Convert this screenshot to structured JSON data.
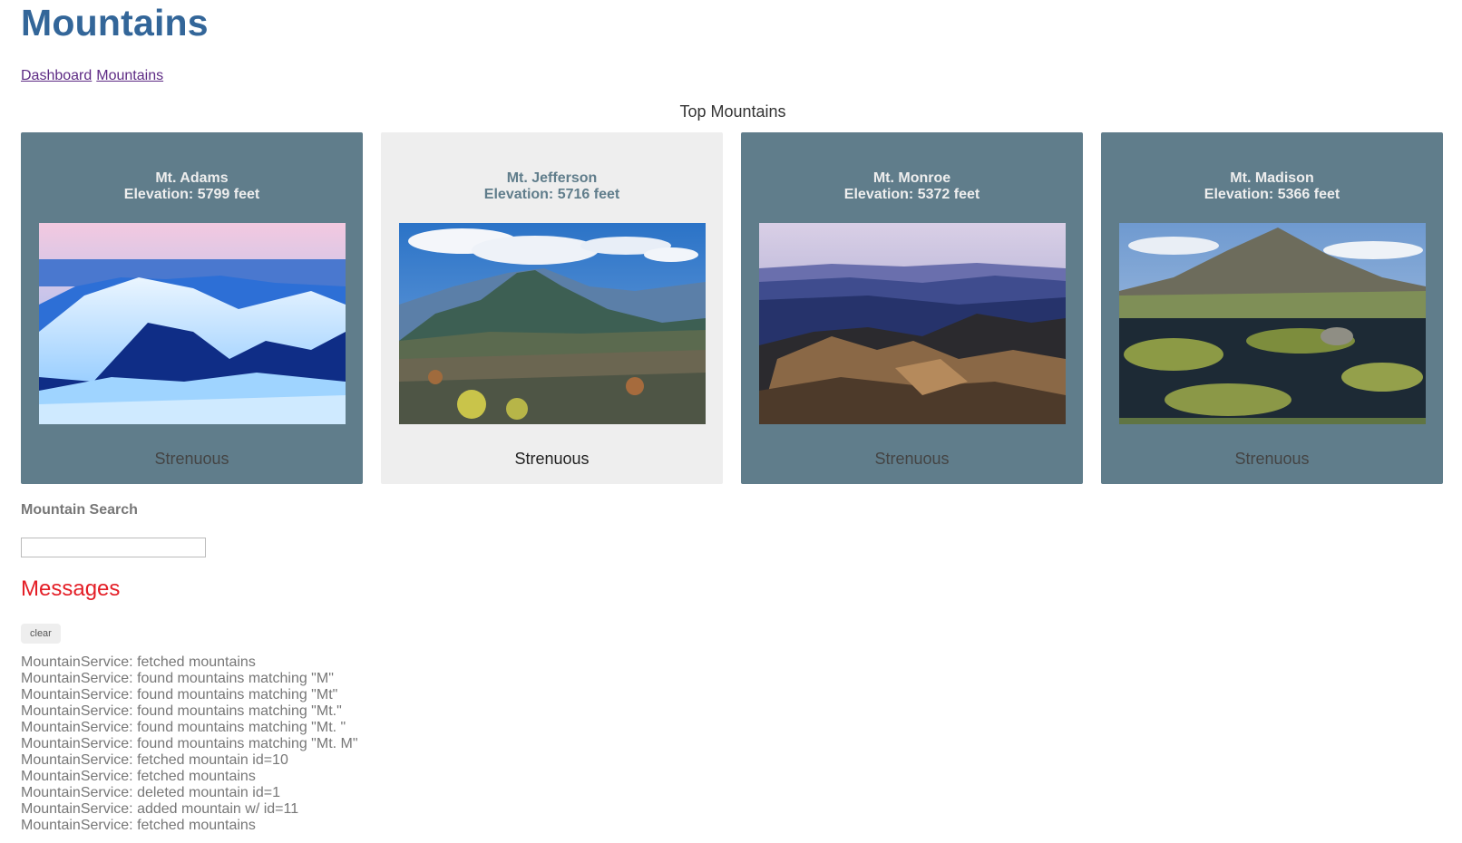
{
  "app": {
    "title": "Mountains"
  },
  "nav": {
    "links": [
      "Dashboard",
      "Mountains"
    ]
  },
  "dashboard": {
    "title": "Top Mountains",
    "cards": [
      {
        "name": "Mt. Adams",
        "elevation": "Elevation: 5799 feet",
        "difficulty": "Strenuous",
        "image": "snowy-ridge-photo"
      },
      {
        "name": "Mt. Jefferson",
        "elevation": "Elevation: 5716 feet",
        "difficulty": "Strenuous",
        "image": "summit-rocky-photo"
      },
      {
        "name": "Mt. Monroe",
        "elevation": "Elevation: 5372 feet",
        "difficulty": "Strenuous",
        "image": "sunset-rocks-photo"
      },
      {
        "name": "Mt. Madison",
        "elevation": "Elevation: 5366 feet",
        "difficulty": "Strenuous",
        "image": "alpine-pond-photo"
      }
    ]
  },
  "search": {
    "label": "Mountain Search",
    "value": "",
    "placeholder": ""
  },
  "messages": {
    "title": "Messages",
    "clear_label": "clear",
    "items": [
      "MountainService: fetched mountains",
      "MountainService: found mountains matching \"M\"",
      "MountainService: found mountains matching \"Mt\"",
      "MountainService: found mountains matching \"Mt.\"",
      "MountainService: found mountains matching \"Mt. \"",
      "MountainService: found mountains matching \"Mt. M\"",
      "MountainService: fetched mountain id=10",
      "MountainService: fetched mountains",
      "MountainService: deleted mountain id=1",
      "MountainService: added mountain w/ id=11",
      "MountainService: fetched mountains"
    ]
  },
  "colors": {
    "title": "#336699",
    "card": "#607d8b",
    "card_highlight": "#eeeeee",
    "messages_title": "#e41e26",
    "link": "#5d2a84"
  }
}
